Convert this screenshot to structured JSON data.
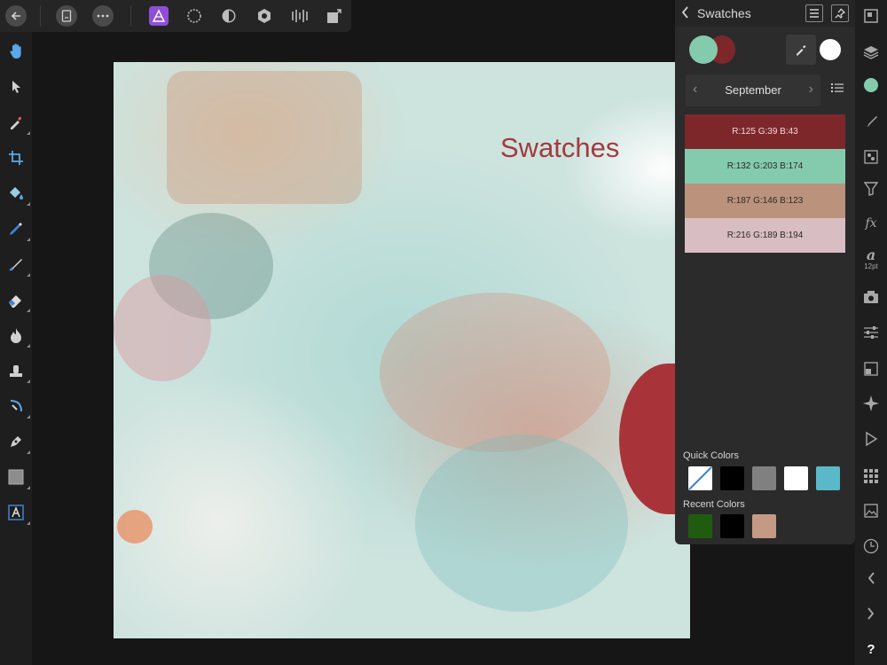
{
  "toolbar": {
    "back_icon": "arrow-left-icon",
    "document_icon": "document-icon",
    "more_icon": "more-icon",
    "personas": [
      "photo-persona-icon",
      "liquify-persona-icon",
      "develop-persona-icon",
      "tone-mapping-persona-icon",
      "export-persona-icon"
    ]
  },
  "left_tools": [
    "hand-icon",
    "move-icon",
    "color-picker-icon",
    "crop-icon",
    "flood-fill-icon",
    "selection-brush-icon",
    "paint-brush-icon",
    "erase-brush-icon",
    "dodge-icon",
    "clone-icon",
    "healing-icon",
    "pen-icon",
    "rectangle-icon",
    "text-icon"
  ],
  "canvas": {
    "title": "Swatches",
    "title_color": "#a23a3f"
  },
  "swatches_panel": {
    "title": "Swatches",
    "fill_color": "#84cbae",
    "stroke_color": "#7d272b",
    "palette": {
      "name": "September",
      "prev_glyph": "‹",
      "next_glyph": "›"
    },
    "swatches": [
      {
        "label": "R:125 G:39 B:43",
        "color": "#7d272b"
      },
      {
        "label": "R:132 G:203 B:174",
        "color": "#84cbae"
      },
      {
        "label": "R:187 G:146 B:123",
        "color": "#bb927b"
      },
      {
        "label": "R:216 G:189 B:194",
        "color": "#d8bdc2"
      }
    ],
    "quick_colors_label": "Quick Colors",
    "quick_colors": [
      "none",
      "#000000",
      "#808080",
      "#ffffff",
      "#5ab8c9"
    ],
    "recent_colors_label": "Recent Colors",
    "recent_colors": [
      "#1f5c10",
      "#000000",
      "#c49a84"
    ]
  },
  "right_bar": {
    "tools": [
      "transform-icon",
      "layers-icon",
      "color-icon",
      "brushes-icon",
      "channels-icon",
      "filters-icon",
      "effects-icon",
      "text-style-icon",
      "snapshots-icon",
      "adjustments-icon",
      "navigator-icon",
      "symbols-icon",
      "macros-icon",
      "stock-icon",
      "assets-icon",
      "history-icon",
      "undo-icon",
      "redo-icon"
    ],
    "text_size_glyph": "a",
    "text_size_label": "12pt",
    "effects_glyph": "fx",
    "help_label": "?"
  }
}
